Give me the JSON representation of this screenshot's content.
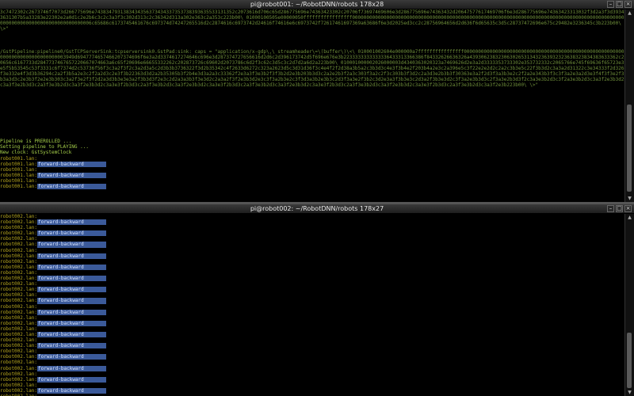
{
  "top": {
    "title": "pi@robot001: ~/RobotDNN/robots 178x28",
    "hex_dump": "3c7472302c2673746f7073d266775696e7438347931383434356373434337353738393635533131352c2073616d706c65d286775696e74363423302c20706f73697469606e3d286775696e74363432d20647577617469706f6e3d286775696e74363423313032f3d2a3f3d39343631307b5a33283e22302e2a0d1c2e2b6c3c2c3a3f3c302d313c2c36342d313a302e363c2a353c223b00\\ 01000100505e00000050fffffffffffffffff0000000000000000000000000000000000000000000000000000000000000000000000000000000000000000000000000000000000000000000000000000006c65686c6173745461676c697374d74247265516d2c2874616c6973742d24616f74616e6c6973742f72617461697369a63686f6e3d2025ed3cc2c28756964656d2d636f6d65635c3d5c28737472696e675c29482e3236345c3b223b00\\ \\>\"",
    "pipeline": "/GstPipeline:pipeline0/GstTCPServerSink:tcpserversink0.GstPad:sink: caps = \"application/x-gdp\\,\\ streamheader\\=\\(buffer\\)\\<\\ 010001002604e000000a7ffffffffffffffff0000000000000000000000000000000000000000000000000000000000000000000000000000003949d6947774657466207374696f6e3a2d3374617274646c696e3d287374727656616d2d6c2d396173742d5f696e676e3b2233333333333336433313366386f84332626636326a4393062383230630265313432363932323638323834383633362c20656c6167733d2847737467657220667074663a6c65f20696e66655332262c202873726c69602d2073786c6d2f3c62c3d5c3c2d7d2a6d2a223b00\\ 010001000002026000003d4340363020323a7469626d2e3a2d3333353733302e353732332c2065766e745f69636f65723e3e5f5b53545c53f3331c6f7374d2c53736f56f3c3a2f3f2c3a2d3a5c2d3b3b3736322f3d2b35342c4f2633d6272c323a2623d5c3d31d36f3c4e4f2f2d38a3b5a2c3b3d3c4e3f3b4e2f203b4a2e3c2a396e5c3f22e2e2d2c2a2c3b3e5c22f3b3d2c3a3a2d31322c3e34333f2d326f3e332e4f3d3b36294c2a2f3b5a2e3c2f2a2d3c2e3f3b22363d3d2a2b35305b3f2b4e3d3a2a3c33362f2e3a3f3e3b2f3f3b2d2e3b203b3d3c2a2e2b3f2a3c303f3a2c2f3c303b3f3d2c2a3d3e2b3b3f30363e3a2f2d3f3a3b3e2c2f2a2e343b3f3c3f3a2e3a2d3e3f4f3f3e2f3b3a3d3c2e3b3f2e2e3b303c3a2f3e2f3f2d2a3d3b3e3e3a2f3b3d3f2e3c2d2a3a3b3f3e3d2c2a3a2f3f2e3b3d2e3c3f3a2b3e2c3f3d3a3b2e3b3c2d3f3a3e2f3b2c3d2e3a3f3b3e3c2d3a2f3b3e3d2c3f3a2e3b3d3c2f3a3e2b3d3f2c3a3e3b2d3c3f2a3e3b2d3c3a3f2e3b3d2c3a3f3e2b3d3c2a3f3e3b2d3c3a3f2e3b3d2c3a3e3f2b3d3c2a3f3e3b2d3c3a3f2e3b3d2c3a3e3f2b3d3c2a3f3e3b2d3c3a3f2e3b3d2c3a3e3f2b3d3c2a3f3e3b2d3c3a3f2e3b3d2c3a3e3f2b3d3c2a3f3e3b2d3c3a3f2e3b223b00\\ \\>\"",
    "preroll": "Pipeline is PREROLLED ...",
    "playing": "Setting pipeline to PLAYING ...",
    "clock": "New clock: GstSystemClock",
    "prompts": [
      {
        "host": "robot001.lan:",
        "text": ""
      },
      {
        "host": "robot001.lan:",
        "text": "forward-backward"
      },
      {
        "host": "robot001.lan:",
        "text": ""
      },
      {
        "host": "robot001.lan:",
        "text": "forward-backward"
      },
      {
        "host": "robot001.lan:",
        "text": ""
      },
      {
        "host": "robot001.lan:",
        "text": "forward-backward"
      }
    ]
  },
  "bottom": {
    "title": "pi@robot002: ~/RobotDNN/robots 178x27",
    "prompts": [
      {
        "host": "robot002.lan:",
        "text": ""
      },
      {
        "host": "robot002.lan:",
        "text": "forward-backward"
      },
      {
        "host": "robot002.lan:",
        "text": ""
      },
      {
        "host": "robot002.lan:",
        "text": "forward-backward"
      },
      {
        "host": "robot002.lan:",
        "text": ""
      },
      {
        "host": "robot002.lan:",
        "text": "forward-backward"
      },
      {
        "host": "robot002.lan:",
        "text": ""
      },
      {
        "host": "robot002.lan:",
        "text": "forward-backward"
      },
      {
        "host": "robot002.lan:",
        "text": ""
      },
      {
        "host": "robot002.lan:",
        "text": "forward-backward"
      },
      {
        "host": "robot002.lan:",
        "text": ""
      },
      {
        "host": "robot002.lan:",
        "text": "forward-backward"
      },
      {
        "host": "robot002.lan:",
        "text": ""
      },
      {
        "host": "robot002.lan:",
        "text": "forward-backward"
      },
      {
        "host": "robot002.lan:",
        "text": ""
      },
      {
        "host": "robot002.lan:",
        "text": "forward-backward"
      },
      {
        "host": "robot002.lan:",
        "text": ""
      },
      {
        "host": "robot002.lan:",
        "text": "forward-backward"
      },
      {
        "host": "robot002.lan:",
        "text": ""
      },
      {
        "host": "robot002.lan:",
        "text": "forward-backward"
      },
      {
        "host": "robot002.lan:",
        "text": ""
      },
      {
        "host": "robot002.lan:",
        "text": "forward-backward"
      },
      {
        "host": "robot002.lan:",
        "text": ""
      },
      {
        "host": "robot002.lan:",
        "text": "forward-backward"
      },
      {
        "host": "robot002.lan:",
        "text": ""
      },
      {
        "host": "robot002.lan:",
        "text": "forward-backward"
      },
      {
        "host": "robot002.lan:",
        "text": ""
      },
      {
        "host": "robot002.lan:",
        "text": "forward-backward"
      },
      {
        "host": "robot002.lan:",
        "text": ""
      },
      {
        "host": "robot002.lan:",
        "text": "forward-backward"
      },
      {
        "host": "robot002.lan:",
        "text": ""
      },
      {
        "host": "robot002.lan:",
        "text": "forward-backward"
      },
      {
        "host": "robot002.lan:",
        "text": ""
      }
    ]
  },
  "window_buttons": {
    "minimize": "–",
    "maximize": "□",
    "close": "×"
  },
  "scroll_arrows": {
    "up": "▲",
    "down": "▼"
  },
  "colors": {
    "prompt": "#b8a81e",
    "selection": "#3b5a9a",
    "output": "#a6d04a",
    "hex": "#6f8f3a"
  }
}
